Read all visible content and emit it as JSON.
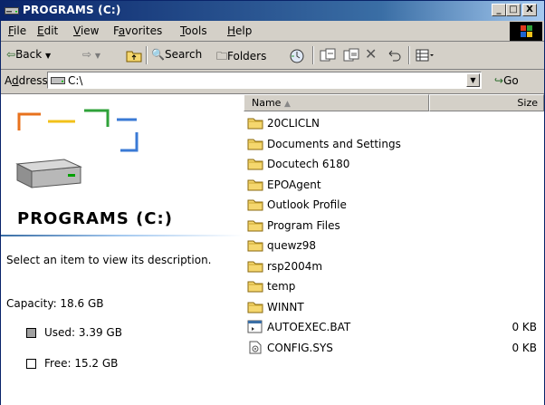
{
  "window": {
    "title": "PROGRAMS (C:)"
  },
  "title_buttons": {
    "minimize": "_",
    "maximize": "□",
    "close": "X"
  },
  "menu": [
    {
      "label": "File",
      "u": "F",
      "rest": "ile"
    },
    {
      "label": "Edit",
      "u": "E",
      "rest": "dit"
    },
    {
      "label": "View",
      "u": "V",
      "rest": "iew"
    },
    {
      "label": "Favorites",
      "pre": "F",
      "u": "a",
      "rest": "vorites"
    },
    {
      "label": "Tools",
      "u": "T",
      "rest": "ools"
    },
    {
      "label": "Help",
      "u": "H",
      "rest": "elp"
    }
  ],
  "toolbar": {
    "back": "Back",
    "search": "Search",
    "folders": "Folders"
  },
  "address": {
    "label": "Address",
    "value": "C:\\",
    "go": "Go"
  },
  "left_pane": {
    "drive_title": "PROGRAMS (C:)",
    "description": "Select an item to view its description.",
    "capacity": "Capacity: 18.6 GB",
    "used": "Used: 3.39 GB",
    "free": "Free: 15.2 GB"
  },
  "columns": {
    "name": "Name",
    "size": "Size"
  },
  "files": [
    {
      "name": "20CLICLN",
      "type": "folder",
      "size": ""
    },
    {
      "name": "Documents and Settings",
      "type": "folder",
      "size": ""
    },
    {
      "name": "Docutech 6180",
      "type": "folder",
      "size": ""
    },
    {
      "name": "EPOAgent",
      "type": "folder",
      "size": ""
    },
    {
      "name": "Outlook Profile",
      "type": "folder",
      "size": ""
    },
    {
      "name": "Program Files",
      "type": "folder",
      "size": ""
    },
    {
      "name": "quewz98",
      "type": "folder",
      "size": ""
    },
    {
      "name": "rsp2004m",
      "type": "folder",
      "size": ""
    },
    {
      "name": "temp",
      "type": "folder",
      "size": ""
    },
    {
      "name": "WINNT",
      "type": "folder",
      "size": ""
    },
    {
      "name": "AUTOEXEC.BAT",
      "type": "bat",
      "size": "0 KB"
    },
    {
      "name": "CONFIG.SYS",
      "type": "sys",
      "size": "0 KB"
    }
  ],
  "colors": {
    "title_start": "#0a246a",
    "title_end": "#a6caf0",
    "chrome": "#d4d0c8",
    "folder": "#f5d76e"
  }
}
